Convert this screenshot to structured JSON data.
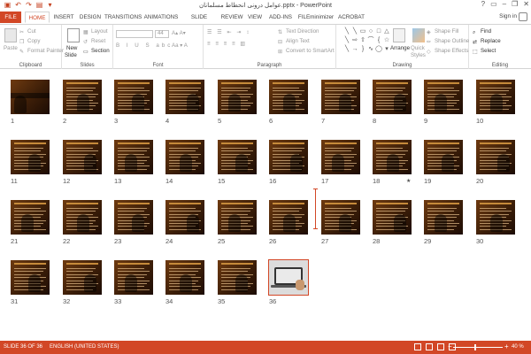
{
  "titlebar": {
    "title": "عوامل درونی انحطاط مسلمانان.pptx - PowerPoint",
    "qat": [
      "save-icon",
      "undo-icon",
      "redo-icon",
      "start-slideshow-icon",
      "customize-icon"
    ],
    "window_controls": [
      "?",
      "▭",
      "–",
      "❐",
      "✕"
    ]
  },
  "tabs": [
    {
      "label": "FILE"
    },
    {
      "label": "HOME"
    },
    {
      "label": "INSERT"
    },
    {
      "label": "DESIGN"
    },
    {
      "label": "TRANSITIONS"
    },
    {
      "label": "ANIMATIONS"
    },
    {
      "label": "SLIDE SHOW"
    },
    {
      "label": "REVIEW"
    },
    {
      "label": "VIEW"
    },
    {
      "label": "ADD-INS"
    },
    {
      "label": "FILEminimizer"
    },
    {
      "label": "ACROBAT"
    }
  ],
  "signin": "Sign in",
  "ribbon": {
    "clipboard": {
      "paste": "Paste",
      "cut": "Cut",
      "copy": "Copy",
      "format_painter": "Format Painter",
      "label": "Clipboard"
    },
    "slides": {
      "new_slide": "New",
      "new_slide2": "Slide",
      "layout": "Layout",
      "reset": "Reset",
      "section": "Section",
      "label": "Slides"
    },
    "font": {
      "font_name": "",
      "font_size": "44",
      "label": "Font"
    },
    "paragraph": {
      "text_direction": "Text Direction",
      "align_text": "Align Text",
      "convert": "Convert to SmartArt",
      "label": "Paragraph"
    },
    "drawing": {
      "arrange": "Arrange",
      "quick_styles": "Quick",
      "quick_styles2": "Styles",
      "shape_fill": "Shape Fill",
      "shape_outline": "Shape Outline",
      "shape_effects": "Shape Effects",
      "label": "Drawing"
    },
    "editing": {
      "find": "Find",
      "replace": "Replace",
      "select": "Select",
      "label": "Editing"
    }
  },
  "slides": [
    {
      "num": "1"
    },
    {
      "num": "2"
    },
    {
      "num": "3"
    },
    {
      "num": "4"
    },
    {
      "num": "5"
    },
    {
      "num": "6"
    },
    {
      "num": "7"
    },
    {
      "num": "8"
    },
    {
      "num": "9"
    },
    {
      "num": "10"
    },
    {
      "num": "11"
    },
    {
      "num": "12"
    },
    {
      "num": "13"
    },
    {
      "num": "14"
    },
    {
      "num": "15"
    },
    {
      "num": "16"
    },
    {
      "num": "17"
    },
    {
      "num": "18"
    },
    {
      "num": "19"
    },
    {
      "num": "20"
    },
    {
      "num": "21"
    },
    {
      "num": "22"
    },
    {
      "num": "23"
    },
    {
      "num": "24"
    },
    {
      "num": "25"
    },
    {
      "num": "26"
    },
    {
      "num": "27"
    },
    {
      "num": "28"
    },
    {
      "num": "29"
    },
    {
      "num": "30"
    },
    {
      "num": "31"
    },
    {
      "num": "32"
    },
    {
      "num": "33"
    },
    {
      "num": "34"
    },
    {
      "num": "35"
    },
    {
      "num": "36"
    }
  ],
  "star_slide": "18",
  "star_glyph": "★",
  "statusbar": {
    "slide_info": "SLIDE 36 OF 36",
    "language": "ENGLISH (UNITED STATES)",
    "zoom": "40 %",
    "minus": "−",
    "plus": "+"
  },
  "colors": {
    "accent": "#d24726"
  }
}
